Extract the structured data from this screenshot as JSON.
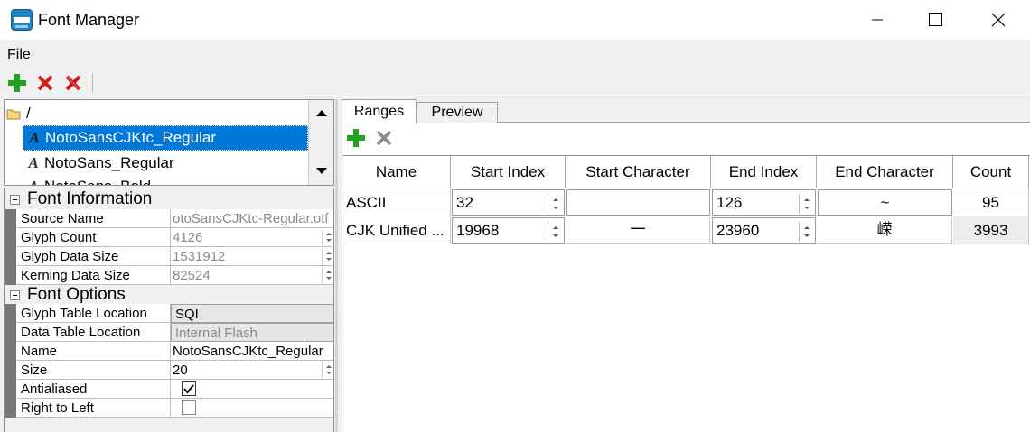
{
  "window": {
    "title": "Font Manager",
    "controls": [
      "minimize-icon",
      "maximize-icon",
      "close-icon"
    ]
  },
  "menu": {
    "file": "File"
  },
  "toolbar": {
    "icons": [
      "add-icon",
      "remove-icon",
      "remove-all-icon"
    ]
  },
  "tree": {
    "root": "/",
    "items": [
      {
        "label": "NotoSansCJKtc_Regular",
        "selected": true
      },
      {
        "label": "NotoSans_Regular",
        "selected": false
      },
      {
        "label": "NotoSans_Bold",
        "selected": false
      }
    ]
  },
  "properties": {
    "font_information": {
      "title": "Font Information",
      "rows": [
        {
          "name": "Source Name",
          "value": "otoSansCJKtc-Regular.otf"
        },
        {
          "name": "Glyph Count",
          "value": "4126"
        },
        {
          "name": "Glyph Data Size",
          "value": "1531912"
        },
        {
          "name": "Kerning Data Size",
          "value": "82524"
        }
      ]
    },
    "font_options": {
      "title": "Font Options",
      "rows": [
        {
          "name": "Glyph Table Location",
          "value": "SQI"
        },
        {
          "name": "Data Table Location",
          "value": "Internal Flash"
        },
        {
          "name": "Name",
          "value": "NotoSansCJKtc_Regular"
        },
        {
          "name": "Size",
          "value": "20"
        },
        {
          "name": "Antialiased",
          "value": "",
          "checked": true
        },
        {
          "name": "Right to Left",
          "value": "",
          "checked": false
        }
      ]
    }
  },
  "tabs": [
    {
      "label": "Ranges",
      "active": true
    },
    {
      "label": "Preview",
      "active": false
    }
  ],
  "ranges": {
    "headers": [
      "Name",
      "Start Index",
      "Start Character",
      "End Index",
      "End Character",
      "Count"
    ],
    "rows": [
      {
        "name": "ASCII",
        "start_index": "32",
        "start_char": "",
        "end_index": "126",
        "end_char": "~",
        "count": "95"
      },
      {
        "name": "CJK Unified ...",
        "start_index": "19968",
        "start_char": "一",
        "end_index": "23960",
        "end_char": "嵘",
        "count": "3993"
      }
    ]
  },
  "colors": {
    "selection": "#0078d7",
    "add_green": "#1fa31f",
    "remove_red": "#d71e1e",
    "disabled_gray": "#8a8a8a"
  }
}
